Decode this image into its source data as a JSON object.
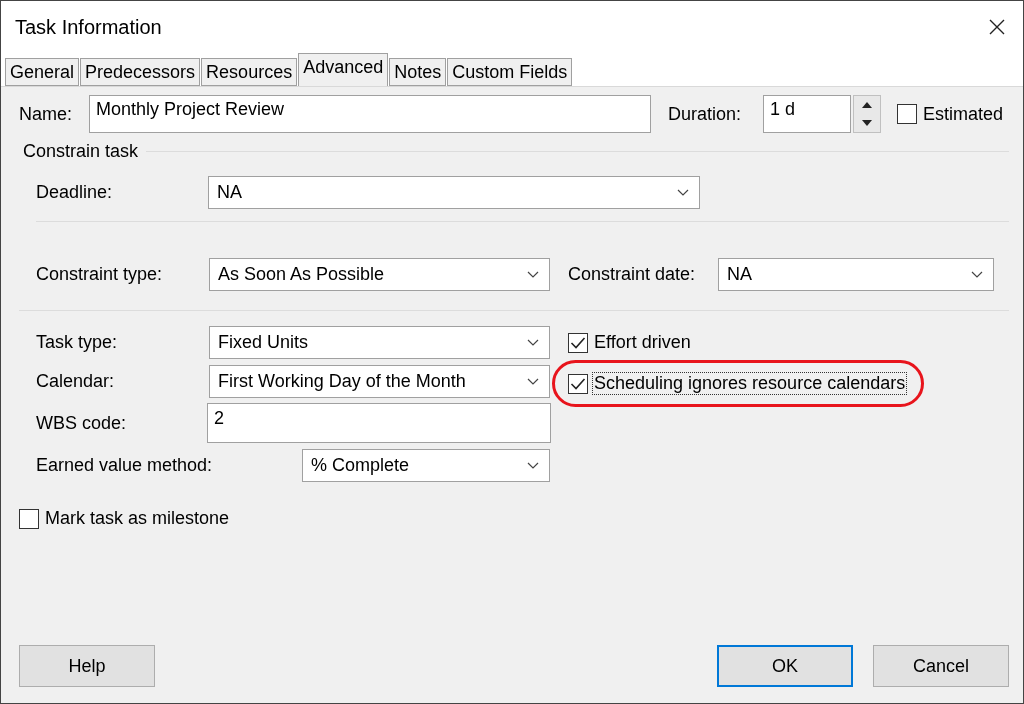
{
  "window": {
    "title": "Task Information"
  },
  "tabs": [
    {
      "label": "General",
      "selected": false
    },
    {
      "label": "Predecessors",
      "selected": false
    },
    {
      "label": "Resources",
      "selected": false
    },
    {
      "label": "Advanced",
      "selected": true
    },
    {
      "label": "Notes",
      "selected": false
    },
    {
      "label": "Custom Fields",
      "selected": false
    }
  ],
  "name": {
    "label": "Name:",
    "value": "Monthly Project Review"
  },
  "duration": {
    "label": "Duration:",
    "value": "1 d"
  },
  "estimated": {
    "label": "Estimated",
    "checked": false
  },
  "constrain_section": {
    "title": "Constrain task"
  },
  "deadline": {
    "label": "Deadline:",
    "value": "NA"
  },
  "constraint_type": {
    "label": "Constraint type:",
    "value": "As Soon As Possible"
  },
  "constraint_date": {
    "label": "Constraint date:",
    "value": "NA"
  },
  "task_type": {
    "label": "Task type:",
    "value": "Fixed Units"
  },
  "calendar": {
    "label": "Calendar:",
    "value": "First Working Day of the Month"
  },
  "wbs_code": {
    "label": "WBS code:",
    "value": "2"
  },
  "earned_value_method": {
    "label": "Earned value method:",
    "value": "% Complete"
  },
  "options": [
    {
      "label": "Effort driven",
      "checked": true,
      "highlighted": false
    },
    {
      "label": "Scheduling ignores resource calendars",
      "checked": true,
      "highlighted": true
    }
  ],
  "milestone": {
    "label": "Mark task as milestone",
    "checked": false
  },
  "buttons": [
    {
      "label": "Help",
      "kind": "help"
    },
    {
      "label": "OK",
      "kind": "default"
    },
    {
      "label": "Cancel",
      "kind": "cancel"
    }
  ]
}
